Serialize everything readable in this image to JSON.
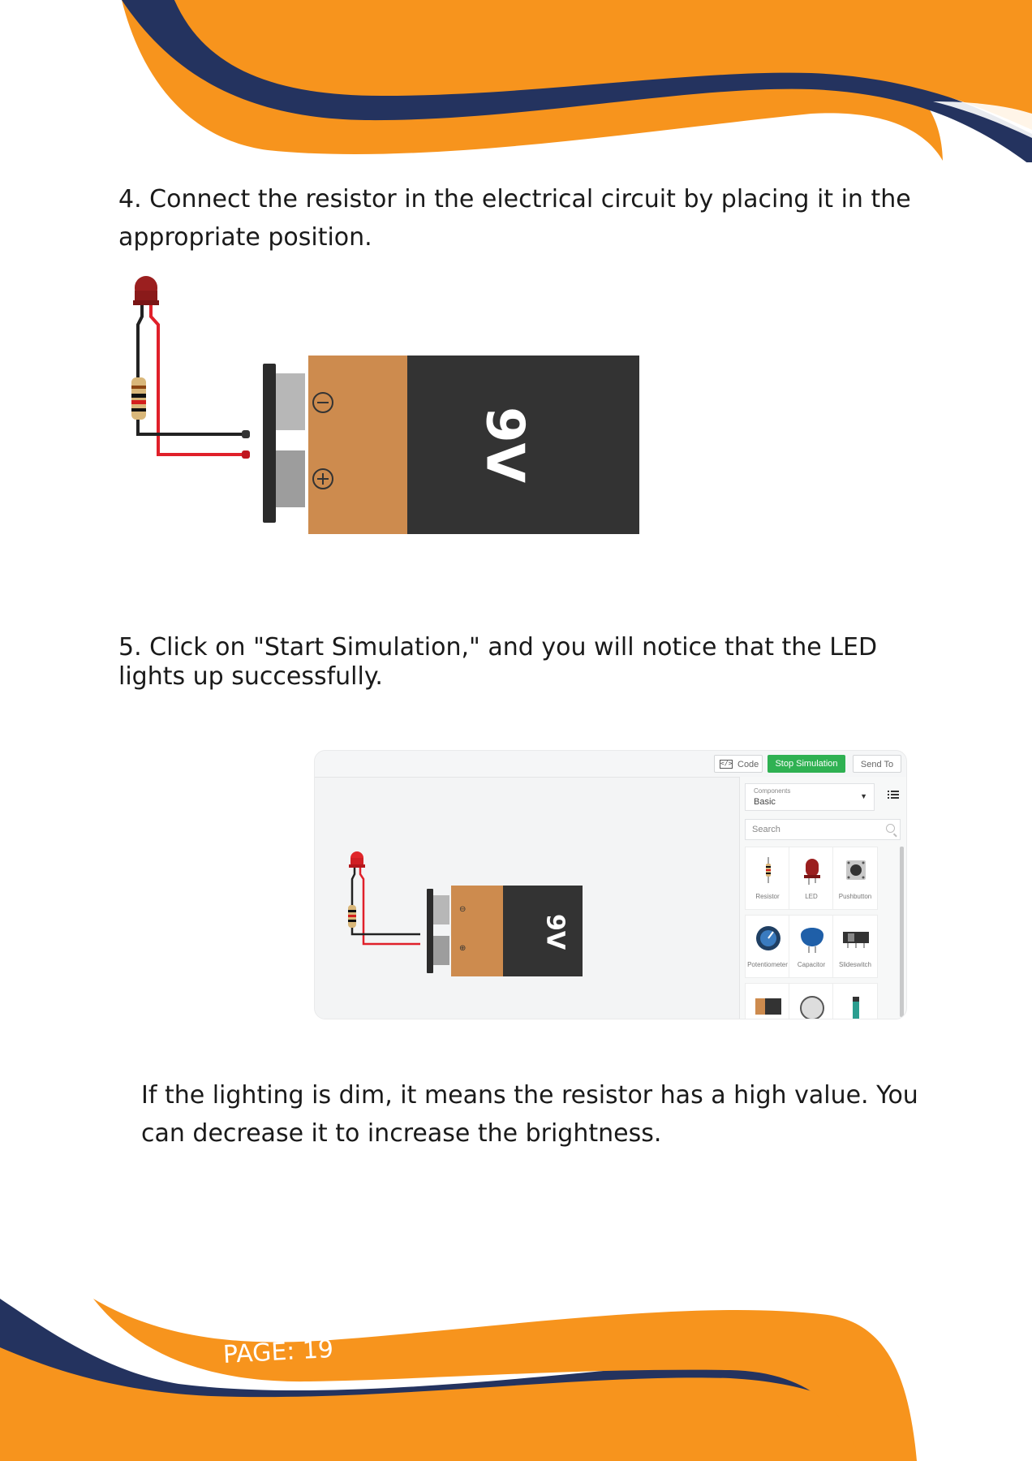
{
  "steps": {
    "step4": "4. Connect the resistor in the electrical circuit by placing it in the appropriate position.",
    "step5": "5. Click on \"Start Simulation,\" and you will notice that the LED lights up successfully.",
    "note": "If the lighting is dim, it means the resistor has a high value. You can decrease it to increase the brightness."
  },
  "battery_label": "9V",
  "simulator": {
    "code_label": "Code",
    "stop_label": "Stop Simulation",
    "send_label": "Send To",
    "components_caption": "Components",
    "components_value": "Basic",
    "search_placeholder": "Search",
    "components": [
      {
        "label": "Resistor",
        "icon": "resistor-icon"
      },
      {
        "label": "LED",
        "icon": "led-icon"
      },
      {
        "label": "Pushbutton",
        "icon": "pushbutton-icon"
      },
      {
        "label": "Potentiometer",
        "icon": "potentiometer-icon"
      },
      {
        "label": "Capacitor",
        "icon": "capacitor-icon"
      },
      {
        "label": "Slideswitch",
        "icon": "slideswitch-icon"
      }
    ]
  },
  "colors": {
    "orange": "#f7941d",
    "navy": "#24335f",
    "battery_copper": "#cd8b4e",
    "battery_body": "#333333",
    "stop_green": "#2fb152"
  },
  "footer": {
    "page_label": "PAGE: 19"
  }
}
